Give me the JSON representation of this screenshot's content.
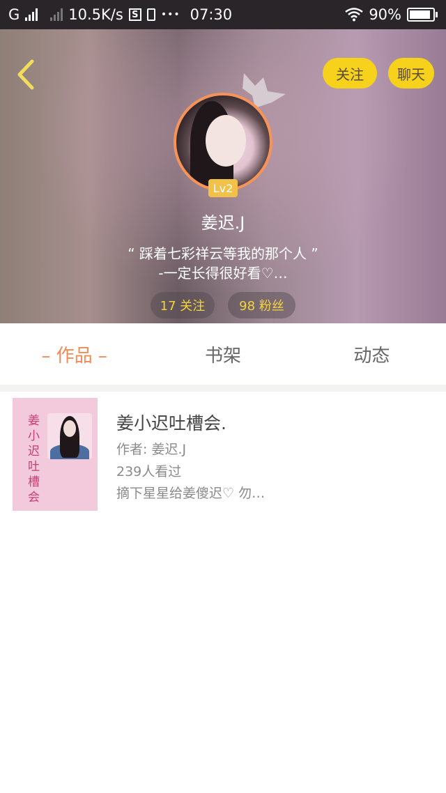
{
  "status_bar": {
    "carrier": "G",
    "speed": "10.5K/s",
    "s_icon": "S",
    "more": "•••",
    "time": "07:30",
    "battery": "90%"
  },
  "profile": {
    "follow_button": "关注",
    "chat_button": "聊天",
    "level": "Lv2",
    "username": "姜迟.J",
    "bio_line1": "“ 踩着七彩祥云等我的那个人 ”",
    "bio_line2": "-一定长得很好看♡…",
    "following": "17 关注",
    "fans": "98 粉丝"
  },
  "tabs": [
    {
      "label": "– 作品 –"
    },
    {
      "label": "书架"
    },
    {
      "label": "动态"
    }
  ],
  "books": [
    {
      "cover_text": "姜小迟吐槽会",
      "title": "姜小迟吐槽会.",
      "author": "作者: 姜迟.J",
      "views": "239人看过",
      "desc": "摘下星星给姜傻迟♡ 勿…"
    }
  ],
  "colors": {
    "accent_orange": "#f18a56",
    "button_yellow": "#f7d21c",
    "stat_yellow": "#f4d43c"
  }
}
